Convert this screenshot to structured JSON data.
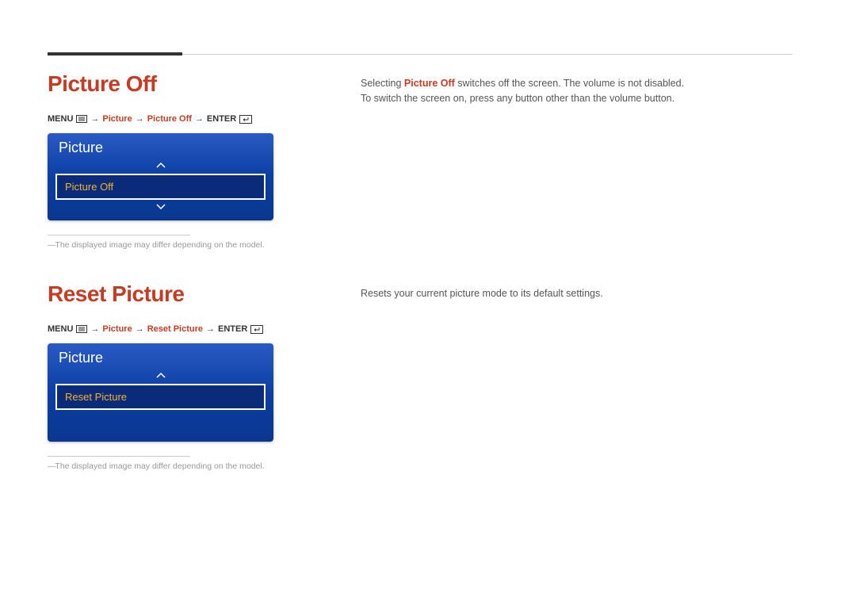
{
  "sections": [
    {
      "title": "Picture Off",
      "breadcrumb": {
        "menu": "MENU",
        "path1": "Picture",
        "path2": "Picture Off",
        "enter": "ENTER"
      },
      "osd": {
        "header": "Picture",
        "item": "Picture Off",
        "show_down_arrow": true
      },
      "footnote": "The displayed image may differ depending on the model.",
      "description": {
        "line1_pre": "Selecting ",
        "line1_bold": "Picture Off",
        "line1_post": " switches off the screen. The volume is not disabled.",
        "line2": "To switch the screen on, press any button other than the volume button."
      }
    },
    {
      "title": "Reset Picture",
      "breadcrumb": {
        "menu": "MENU",
        "path1": "Picture",
        "path2": "Reset Picture",
        "enter": "ENTER"
      },
      "osd": {
        "header": "Picture",
        "item": "Reset Picture",
        "show_down_arrow": false
      },
      "footnote": "The displayed image may differ depending on the model.",
      "description": {
        "line1_pre": "Resets your current picture mode to its default settings.",
        "line1_bold": "",
        "line1_post": "",
        "line2": ""
      }
    }
  ]
}
